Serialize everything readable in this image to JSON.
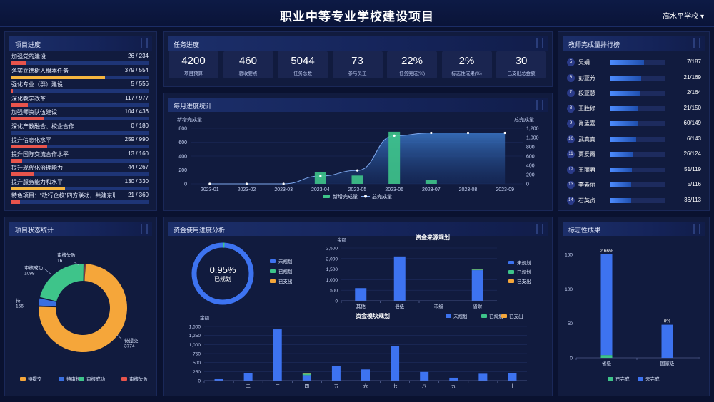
{
  "header": {
    "title": "职业中等专业学校建设项目",
    "school": "高水平学校"
  },
  "panels": {
    "project_progress": "项目进度",
    "task_progress": "任务进度",
    "teacher_rank": "教师完成量排行榜",
    "monthly": "每月进度统计",
    "status": "项目状态统计",
    "funds": "资金使用进度分析",
    "landmark": "标志性成果"
  },
  "project_items": [
    {
      "name": "加强党的建设",
      "count": "26 / 234",
      "ratio": 0.11,
      "color": "#e8544c"
    },
    {
      "name": "落实立德树人根本任务",
      "count": "379 / 554",
      "ratio": 0.68,
      "color": "#f5b53f"
    },
    {
      "name": "强化专业（群）建设",
      "count": "5 / 556",
      "ratio": 0.01,
      "color": "#e8544c"
    },
    {
      "name": "深化教学改革",
      "count": "117 / 977",
      "ratio": 0.12,
      "color": "#e8544c"
    },
    {
      "name": "加强师资队伍建设",
      "count": "104 / 436",
      "ratio": 0.24,
      "color": "#e8544c"
    },
    {
      "name": "深化产教融合、校企合作",
      "count": "0 / 180",
      "ratio": 0.0,
      "color": "#e8544c"
    },
    {
      "name": "提升信息化水平",
      "count": "259 / 990",
      "ratio": 0.26,
      "color": "#e8544c"
    },
    {
      "name": "提升国际交流合作水平",
      "count": "13 / 160",
      "ratio": 0.08,
      "color": "#e8544c"
    },
    {
      "name": "提升现代化治理能力",
      "count": "44 / 267",
      "ratio": 0.16,
      "color": "#e8544c"
    },
    {
      "name": "提升服务能力和水平",
      "count": "130 / 330",
      "ratio": 0.39,
      "color": "#f5b53f"
    },
    {
      "name": "特色项目：“政行企校”四方联动，共建东职数…",
      "count": "21 / 360",
      "ratio": 0.06,
      "color": "#e8544c"
    }
  ],
  "task_stats": [
    {
      "value": "4200",
      "label": "项目预算"
    },
    {
      "value": "460",
      "label": "验收要点"
    },
    {
      "value": "5044",
      "label": "任务总数"
    },
    {
      "value": "73",
      "label": "参与员工"
    },
    {
      "value": "22%",
      "label": "任务完成(%)"
    },
    {
      "value": "2%",
      "label": "标志性成果(%)"
    },
    {
      "value": "30",
      "label": "已支出总金额"
    }
  ],
  "ranking": [
    {
      "no": "5",
      "name": "吴娟",
      "value": "7/187",
      "ratio": 0.62
    },
    {
      "no": "6",
      "name": "彭亚芳",
      "value": "21/169",
      "ratio": 0.57
    },
    {
      "no": "7",
      "name": "段亚慧",
      "value": "2/164",
      "ratio": 0.55
    },
    {
      "no": "8",
      "name": "王胜修",
      "value": "21/150",
      "ratio": 0.5
    },
    {
      "no": "9",
      "name": "肖孟嘉",
      "value": "60/149",
      "ratio": 0.5
    },
    {
      "no": "10",
      "name": "武真真",
      "value": "6/143",
      "ratio": 0.48
    },
    {
      "no": "11",
      "name": "贾爱霞",
      "value": "26/124",
      "ratio": 0.42
    },
    {
      "no": "12",
      "name": "王丽君",
      "value": "51/119",
      "ratio": 0.4
    },
    {
      "no": "13",
      "name": "李素丽",
      "value": "5/116",
      "ratio": 0.39
    },
    {
      "no": "14",
      "name": "石英贞",
      "value": "36/113",
      "ratio": 0.38
    }
  ],
  "chart_data": [
    {
      "id": "monthly",
      "type": "bar",
      "categories": [
        "2023-01",
        "2023-02",
        "2023-03",
        "2023-04",
        "2023-05",
        "2023-06",
        "2023-07",
        "2023-08",
        "2023-09"
      ],
      "ylabel": "新增完成量",
      "ylabel_right": "总完成量",
      "ylim": [
        0,
        800
      ],
      "ylim_right": [
        0,
        1200
      ],
      "yticks": [
        "0",
        "200",
        "400",
        "600",
        "800"
      ],
      "yticks_right": [
        "0",
        "200",
        "400",
        "600",
        "800",
        "1,000",
        "1,200"
      ],
      "series": [
        {
          "name": "新增完成量",
          "type": "bar",
          "values": [
            0,
            0,
            0,
            170,
            120,
            750,
            60,
            0,
            0
          ]
        },
        {
          "name": "总完成量",
          "type": "line",
          "values": [
            0,
            0,
            0,
            170,
            290,
            1040,
            1100,
            1100,
            1100
          ]
        }
      ],
      "legend_position": "bottom"
    },
    {
      "id": "status",
      "type": "pie",
      "slices": [
        {
          "name": "待提交",
          "value": 3774,
          "color": "#f5a63a"
        },
        {
          "name": "待审核",
          "value": 156,
          "color": "#3a6fe0"
        },
        {
          "name": "审核成功",
          "value": 1098,
          "color": "#3ec48a"
        },
        {
          "name": "审核失败",
          "value": 16,
          "color": "#e8544c"
        }
      ],
      "labels": [
        "待提交\n3774",
        "待\n156",
        "审核成功\n1098",
        "审核失败\n16"
      ],
      "legend_position": "bottom"
    },
    {
      "id": "funds_gauge",
      "type": "pie",
      "center_value": "0.95%",
      "center_label": "已规划",
      "legend": [
        "未规划",
        "已规划",
        "已支出"
      ],
      "colors": [
        "#3d73f0",
        "#3ec48a",
        "#f5a63a"
      ]
    },
    {
      "id": "funds_source",
      "type": "bar",
      "title": "资金来源规划",
      "ylabel": "金额",
      "categories": [
        "其他",
        "县级",
        "市级",
        "省财"
      ],
      "ylim": [
        0,
        2500
      ],
      "yticks": [
        "0",
        "500",
        "1,000",
        "1,500",
        "2,000",
        "2,500"
      ],
      "series": [
        {
          "name": "未规划",
          "values": [
            600,
            2100,
            0,
            1450
          ]
        },
        {
          "name": "已规划",
          "values": [
            0,
            0,
            0,
            30
          ]
        },
        {
          "name": "已支出",
          "values": [
            0,
            0,
            0,
            10
          ]
        }
      ],
      "legend_position": "right"
    },
    {
      "id": "funds_module",
      "type": "bar",
      "title": "资金模块规划",
      "ylabel": "金额",
      "categories": [
        "一",
        "二",
        "三",
        "四",
        "五",
        "六",
        "七",
        "八",
        "九",
        "十",
        "十"
      ],
      "ylim": [
        0,
        1500
      ],
      "yticks": [
        "0",
        "250",
        "500",
        "750",
        "1,000",
        "1,250",
        "1,500"
      ],
      "series": [
        {
          "name": "未规划",
          "values": [
            40,
            200,
            1420,
            150,
            400,
            310,
            950,
            240,
            80,
            190,
            200
          ]
        },
        {
          "name": "已规划",
          "values": [
            0,
            0,
            0,
            40,
            0,
            0,
            0,
            0,
            0,
            0,
            0
          ]
        },
        {
          "name": "已支出",
          "values": [
            0,
            0,
            0,
            10,
            0,
            0,
            0,
            0,
            0,
            0,
            0
          ]
        }
      ],
      "legend_position": "top-right"
    },
    {
      "id": "landmark",
      "type": "bar",
      "categories": [
        "省级",
        "国家级"
      ],
      "ylim": [
        0,
        150
      ],
      "yticks": [
        "0",
        "50",
        "100",
        "150"
      ],
      "data_labels": [
        "2.66%",
        "0%"
      ],
      "series": [
        {
          "name": "已完成",
          "values": [
            4,
            0
          ]
        },
        {
          "name": "未完成",
          "values": [
            146,
            48
          ]
        }
      ],
      "legend_position": "bottom"
    }
  ],
  "colors": {
    "blue": "#3d73f0",
    "green": "#3ec48a",
    "orange": "#f5a63a",
    "red": "#e8544c"
  }
}
